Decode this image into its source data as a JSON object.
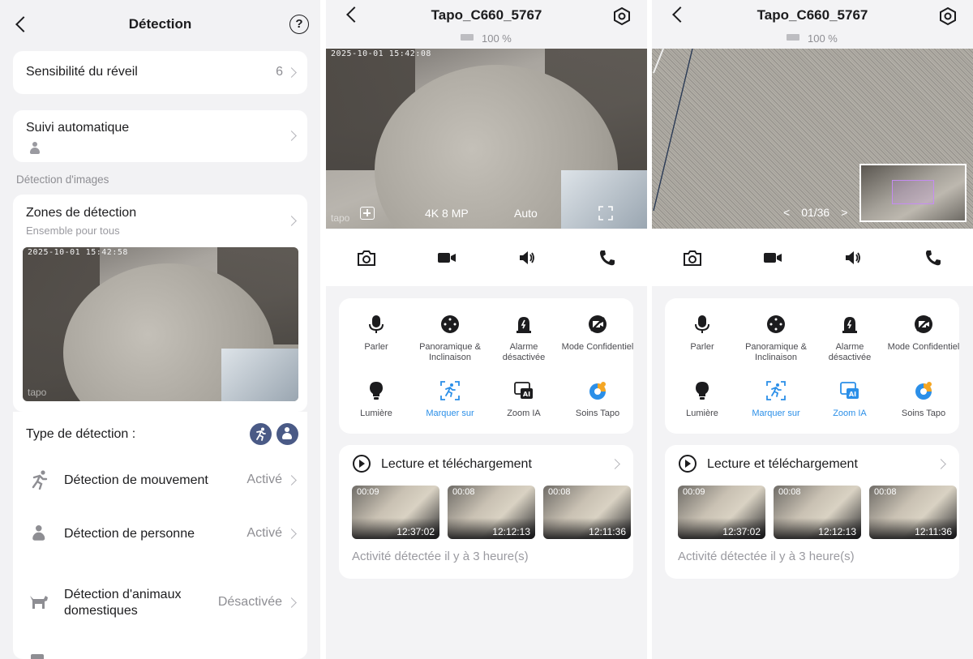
{
  "panel1": {
    "title": "Détection",
    "wake_sensitivity": {
      "label": "Sensibilité du réveil",
      "value": "6"
    },
    "auto_tracking": {
      "label": "Suivi automatique"
    },
    "section_caption": "Détection d'images",
    "zones": {
      "label": "Zones de détection",
      "sublabel": "Ensemble pour tous"
    },
    "camera_timestamp": "2025-10-01 15:42:58",
    "camera_logo": "tapo",
    "detection_type_label": "Type de détection :",
    "rows": [
      {
        "label": "Détection de mouvement",
        "value": "Activé"
      },
      {
        "label": "Détection de personne",
        "value": "Activé"
      },
      {
        "label": "Détection d'animaux domestiques",
        "value": "Désactivée"
      }
    ]
  },
  "panel2": {
    "title": "Tapo_C660_5767",
    "battery": "100 %",
    "video_timestamp": "2025-10-01 15:42:08",
    "video_logo": "tapo",
    "resolution": "4K 8 MP",
    "mode": "Auto",
    "features": [
      {
        "label": "Parler",
        "icon": "microphone-icon"
      },
      {
        "label": "Panoramique & Inclinaison",
        "icon": "pan-tilt-icon"
      },
      {
        "label": "Alarme désactivée",
        "icon": "alarm-icon"
      },
      {
        "label": "Mode Confidentiel",
        "icon": "privacy-icon"
      },
      {
        "label": "Lumière",
        "icon": "bulb-icon"
      },
      {
        "label": "Marquer sur",
        "icon": "track-icon"
      },
      {
        "label": "Zoom IA",
        "icon": "ai-zoom-icon"
      },
      {
        "label": "Soins Tapo",
        "icon": "tapo-care-icon"
      }
    ],
    "playback_title": "Lecture et téléchargement",
    "thumbs": [
      {
        "duration": "00:09",
        "time": "12:37:02"
      },
      {
        "duration": "00:08",
        "time": "12:12:13"
      },
      {
        "duration": "00:08",
        "time": "12:11:36"
      }
    ],
    "activity": "Activité détectée il y à 3 heure(s)"
  },
  "panel3": {
    "title": "Tapo_C660_5767",
    "battery": "100 %",
    "page_indicator": "01/36",
    "prev": "<",
    "next": ">",
    "features": [
      {
        "label": "Parler"
      },
      {
        "label": "Panoramique & Inclinaison"
      },
      {
        "label": "Alarme désactivée"
      },
      {
        "label": "Mode Confidentiel"
      },
      {
        "label": "Lumière"
      },
      {
        "label": "Marquer sur"
      },
      {
        "label": "Zoom IA"
      },
      {
        "label": "Soins Tapo"
      }
    ],
    "playback_title": "Lecture et téléchargement",
    "thumbs": [
      {
        "duration": "00:09",
        "time": "12:37:02"
      },
      {
        "duration": "00:08",
        "time": "12:12:13"
      },
      {
        "duration": "00:08",
        "time": "12:11:36"
      }
    ],
    "activity": "Activité détectée il y à 3 heure(s)"
  },
  "colors": {
    "accent": "#2b8fe8",
    "badge": "#4a5a86",
    "background": "#f2f2f4",
    "tapo_care": "#f5a623"
  }
}
